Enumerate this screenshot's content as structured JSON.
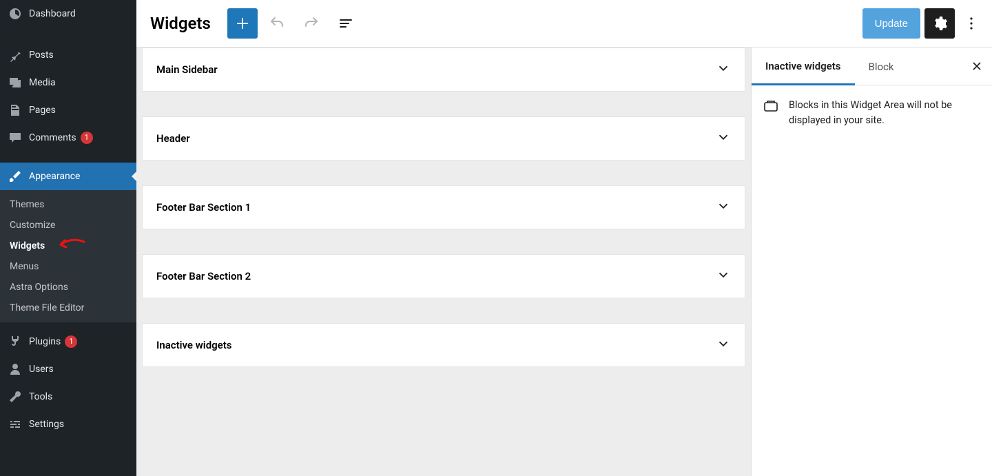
{
  "sidebar": {
    "items": [
      {
        "label": "Dashboard",
        "icon": "dashboard"
      },
      {
        "label": "Posts",
        "icon": "pin"
      },
      {
        "label": "Media",
        "icon": "media"
      },
      {
        "label": "Pages",
        "icon": "pages"
      },
      {
        "label": "Comments",
        "icon": "comment",
        "badge": "1"
      },
      {
        "label": "Appearance",
        "icon": "brush",
        "active": true
      },
      {
        "label": "Plugins",
        "icon": "plug",
        "badge": "1"
      },
      {
        "label": "Users",
        "icon": "user"
      },
      {
        "label": "Tools",
        "icon": "wrench"
      },
      {
        "label": "Settings",
        "icon": "sliders"
      }
    ],
    "appearance_sub": [
      {
        "label": "Themes"
      },
      {
        "label": "Customize"
      },
      {
        "label": "Widgets",
        "current": true
      },
      {
        "label": "Menus"
      },
      {
        "label": "Astra Options"
      },
      {
        "label": "Theme File Editor"
      }
    ]
  },
  "editor": {
    "title": "Widgets",
    "update_label": "Update"
  },
  "widget_areas": [
    {
      "label": "Main Sidebar"
    },
    {
      "label": "Header"
    },
    {
      "label": "Footer Bar Section 1"
    },
    {
      "label": "Footer Bar Section 2"
    },
    {
      "label": "Inactive widgets"
    }
  ],
  "settings_panel": {
    "tabs": [
      {
        "label": "Inactive widgets",
        "active": true
      },
      {
        "label": "Block"
      }
    ],
    "message": "Blocks in this Widget Area will not be displayed in your site."
  }
}
